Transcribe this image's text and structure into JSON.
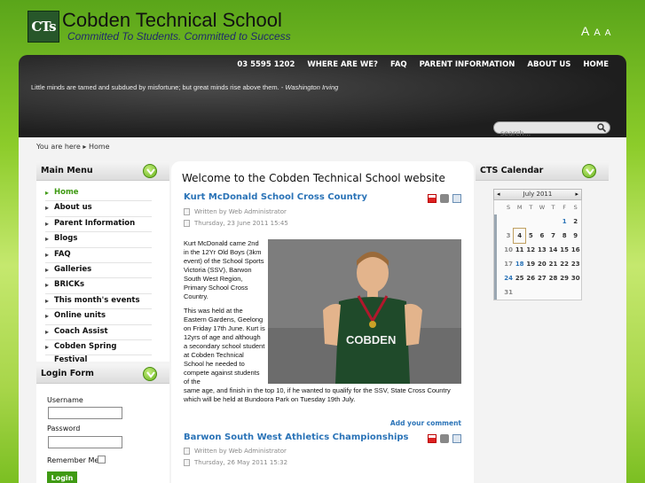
{
  "header": {
    "logo_text": "CTs",
    "title": "Cobden Technical School",
    "subtitle": "Committed To Students. Committed to Success",
    "font_sizes": [
      "A",
      "A",
      "A"
    ]
  },
  "nav": {
    "items": [
      "03 5595 1202",
      "WHERE ARE WE?",
      "FAQ",
      "PARENT INFORMATION",
      "ABOUT US",
      "HOME"
    ]
  },
  "quote": {
    "text": "Little minds are tamed and subdued by misfortune; but great minds rise above them. -",
    "author": "Washington Irving"
  },
  "search": {
    "placeholder": "search..."
  },
  "breadcrumb": {
    "prefix": "You are here",
    "current": "Home"
  },
  "main_menu": {
    "title": "Main Menu",
    "items": [
      "Home",
      "About us",
      "Parent Information",
      "Blogs",
      "FAQ",
      "Galleries",
      "BRICKs",
      "This month's events",
      "Online units",
      "Coach Assist",
      "Cobden Spring Festival"
    ]
  },
  "login": {
    "title": "Login Form",
    "username_label": "Username",
    "password_label": "Password",
    "remember_label": "Remember Me",
    "button": "Login"
  },
  "main": {
    "welcome": "Welcome to the Cobden Technical School website",
    "articles": [
      {
        "title": "Kurt McDonald School Cross Country",
        "author": "Written by Web Administrator",
        "date": "Thursday, 23 June 2011 15:45",
        "p1": "Kurt McDonald came 2nd in the 12Yr Old Boys (3km event) of the School Sports Victoria (SSV), Barwon South West Region, Primary School Cross Country.",
        "p2a": "This was held at the Eastern Gardens, Geelong on Friday 17th June. Kurt is 12yrs of age and although a secondary school student at Cobden Technical School he needed to compete against students of the",
        "p2b": "same age, and finish in the top 10,  if he wanted to qualify for the SSV, State Cross Country which will be held at Bundoora Park on Tuesday 19th July.",
        "comment": "Add your comment",
        "jersey": "COBDEN"
      },
      {
        "title": "Barwon South West Athletics Championships",
        "author": "Written by Web Administrator",
        "date": "Thursday, 26 May 2011 15:32"
      }
    ]
  },
  "calendar": {
    "title": "CTS Calendar",
    "month": "July 2011",
    "days": [
      "S",
      "M",
      "T",
      "W",
      "T",
      "F",
      "S"
    ],
    "weeks": [
      {
        "wk": "",
        "d": [
          "",
          "",
          "",
          "",
          "",
          "1",
          "2"
        ]
      },
      {
        "wk": "",
        "d": [
          "3",
          "4",
          "5",
          "6",
          "7",
          "8",
          "9"
        ]
      },
      {
        "wk": "",
        "d": [
          "10",
          "11",
          "12",
          "13",
          "14",
          "15",
          "16"
        ]
      },
      {
        "wk": "",
        "d": [
          "17",
          "18",
          "19",
          "20",
          "21",
          "22",
          "23"
        ]
      },
      {
        "wk": "",
        "d": [
          "24",
          "25",
          "26",
          "27",
          "28",
          "29",
          "30"
        ]
      },
      {
        "wk": "",
        "d": [
          "31",
          "",
          "",
          "",
          "",
          "",
          ""
        ]
      }
    ]
  },
  "colors": {
    "accent_green": "#3f9a13",
    "link_blue": "#2a73b7",
    "header_dark": "#1e1e1e"
  }
}
